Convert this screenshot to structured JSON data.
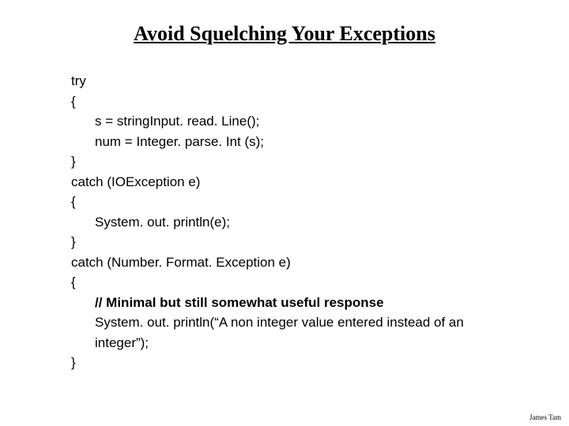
{
  "title": "Avoid Squelching Your Exceptions",
  "code": {
    "l1": "try",
    "l2": "{",
    "l3": "s = stringInput. read. Line();",
    "l4": "num = Integer. parse. Int (s);",
    "l5": "}",
    "l6": "catch (IOException e)",
    "l7": "{",
    "l8": "System. out. println(e);",
    "l9": "}",
    "l10": "catch (Number. Format. Exception e)",
    "l11": "{",
    "l12": "// Minimal but still somewhat useful response",
    "l13": "System. out. println(“A non integer value entered instead of an integer”);",
    "l14": "}"
  },
  "footer": "James Tam"
}
